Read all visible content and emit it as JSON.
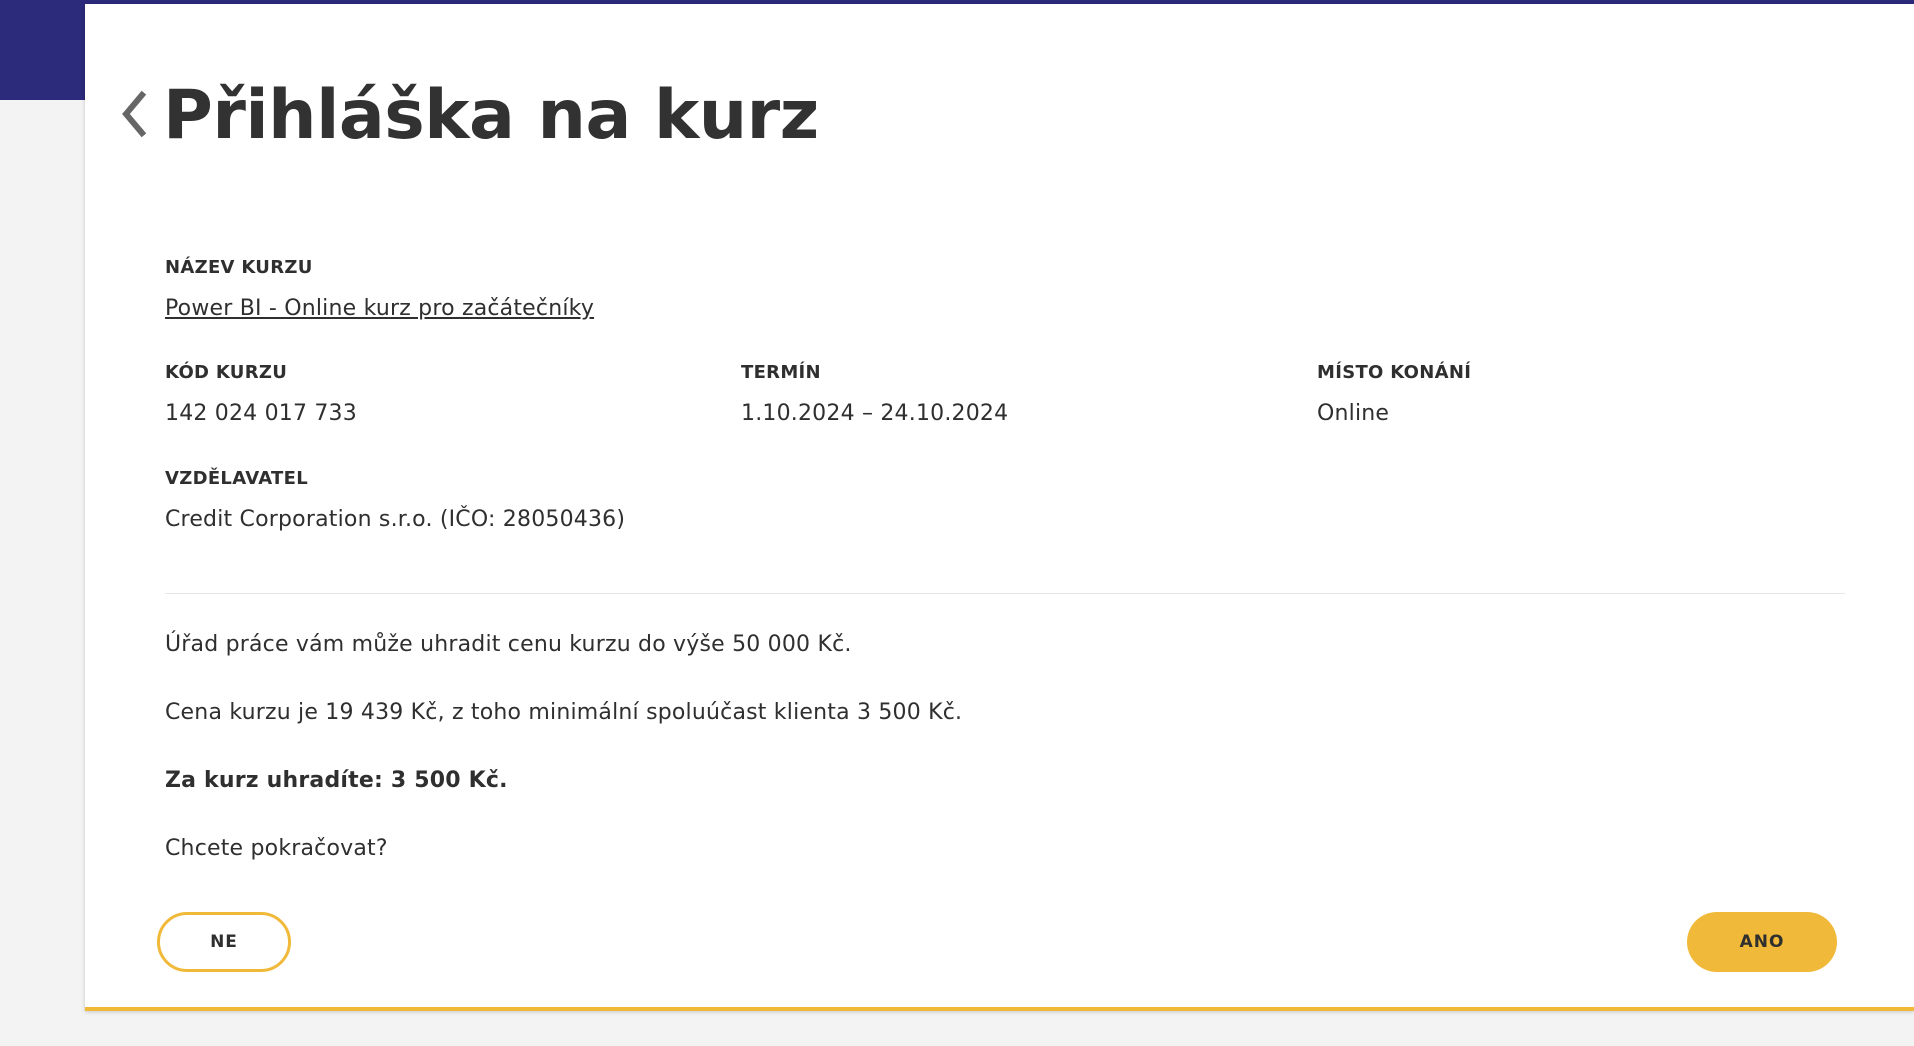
{
  "page": {
    "title": "Přihláška na kurz"
  },
  "course": {
    "name_label": "NÁZEV KURZU",
    "name_value": "Power BI - Online kurz pro začátečníky",
    "code_label": "KÓD KURZU",
    "code_value": "142 024 017 733",
    "term_label": "TERMÍN",
    "term_value": "1.10.2024 – 24.10.2024",
    "place_label": "MÍSTO KONÁNÍ",
    "place_value": "Online",
    "provider_label": "VZDĚLAVATEL",
    "provider_value": "Credit Corporation s.r.o. (IČO: 28050436)"
  },
  "info": {
    "line1": "Úřad práce vám může uhradit cenu kurzu do výše 50 000 Kč.",
    "line2": "Cena kurzu je 19 439 Kč, z toho minimální spoluúčast klienta 3 500 Kč.",
    "line3": "Za kurz uhradíte: 3 500 Kč.",
    "question": "Chcete pokračovat?"
  },
  "actions": {
    "no_label": "NE",
    "yes_label": "ANO"
  },
  "icons": {
    "back": "chevron-left-icon"
  },
  "colors": {
    "brand_navy": "#2c2a7a",
    "accent_yellow": "#f0b93a",
    "text": "#2f2f2f"
  }
}
